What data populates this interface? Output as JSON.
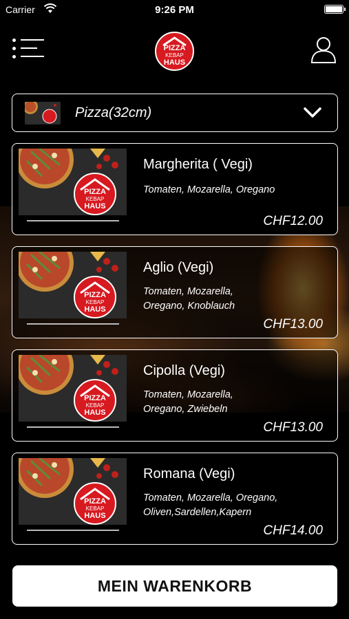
{
  "status_bar": {
    "carrier": "Carrier",
    "time": "9:26 PM"
  },
  "header": {
    "logo_line1": "PIZZA",
    "logo_line2": "KEBAP",
    "logo_line3": "HAUS"
  },
  "category": {
    "selected": "Pizza(32cm)"
  },
  "items": [
    {
      "name": "Margherita ( Vegi)",
      "desc_lines": [
        "Tomaten, Mozarella, Oregano"
      ],
      "price": "CHF12.00"
    },
    {
      "name": "Aglio (Vegi)",
      "desc_lines": [
        "Tomaten, Mozarella,",
        "Oregano, Knoblauch"
      ],
      "price": "CHF13.00"
    },
    {
      "name": "Cipolla (Vegi)",
      "desc_lines": [
        "Tomaten, Mozarella,",
        "Oregano, Zwiebeln"
      ],
      "price": "CHF13.00"
    },
    {
      "name": "Romana (Vegi)",
      "desc_lines": [
        "Tomaten, Mozarella, Oregano,",
        "Oliven,Sardellen,Kapern"
      ],
      "price": "CHF14.00"
    }
  ],
  "cart_button": {
    "label": "MEIN WARENKORB"
  },
  "colors": {
    "brand_red": "#d71920",
    "background": "#000000"
  },
  "icons": {
    "menu": "menu-icon",
    "user": "user-icon",
    "dropdown": "chevron-down-icon"
  }
}
